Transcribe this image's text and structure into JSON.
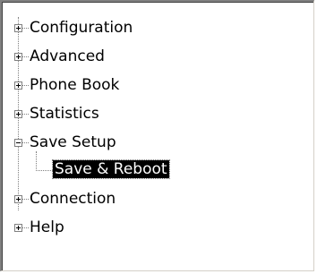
{
  "tree": {
    "items": [
      {
        "label": "Configuration",
        "expanded": false,
        "icon": "plus-expander-icon"
      },
      {
        "label": "Advanced",
        "expanded": false,
        "icon": "plus-expander-icon"
      },
      {
        "label": "Phone Book",
        "expanded": false,
        "icon": "plus-expander-icon"
      },
      {
        "label": "Statistics",
        "expanded": false,
        "icon": "plus-expander-icon"
      },
      {
        "label": "Save Setup",
        "expanded": true,
        "icon": "minus-expander-icon",
        "children": [
          {
            "label": "Save & Reboot",
            "selected": true
          }
        ]
      },
      {
        "label": "Connection",
        "expanded": false,
        "icon": "plus-expander-icon"
      },
      {
        "label": "Help",
        "expanded": false,
        "icon": "plus-expander-icon"
      }
    ]
  },
  "colors": {
    "selection_bg": "#000000",
    "selection_fg": "#ffffff",
    "connector": "#808080",
    "border": "#808080"
  }
}
